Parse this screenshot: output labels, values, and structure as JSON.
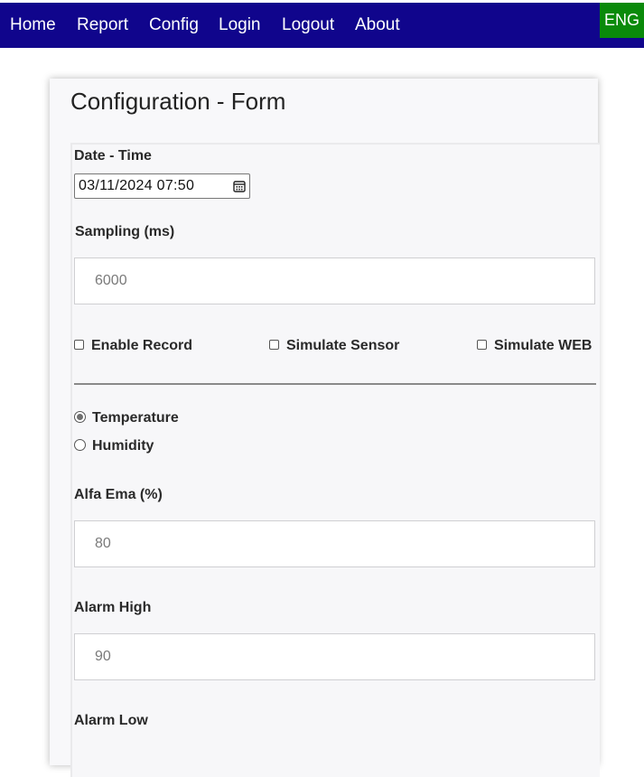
{
  "nav": {
    "items": [
      {
        "label": "Home"
      },
      {
        "label": "Report"
      },
      {
        "label": "Config"
      },
      {
        "label": "Login"
      },
      {
        "label": "Logout"
      },
      {
        "label": "About"
      }
    ],
    "language": "ENG"
  },
  "colors": {
    "navbar": "#10058c",
    "language_badge": "#0a8a0a"
  },
  "form": {
    "title": "Configuration - Form",
    "datetime": {
      "label": "Date - Time",
      "value": "03/11/2024 07:50",
      "icon": "calendar-icon"
    },
    "sampling": {
      "label": "Sampling (ms)",
      "value": "6000"
    },
    "checkboxes": [
      {
        "label": "Enable Record",
        "checked": false
      },
      {
        "label": "Simulate Sensor",
        "checked": false
      },
      {
        "label": "Simulate WEB",
        "checked": false
      }
    ],
    "sensor_type": {
      "options": [
        {
          "label": "Temperature",
          "checked": true
        },
        {
          "label": "Humidity",
          "checked": false
        }
      ]
    },
    "alfa_ema": {
      "label": "Alfa Ema (%)",
      "value": "80"
    },
    "alarm_high": {
      "label": "Alarm High",
      "value": "90"
    },
    "alarm_low": {
      "label": "Alarm Low"
    }
  }
}
